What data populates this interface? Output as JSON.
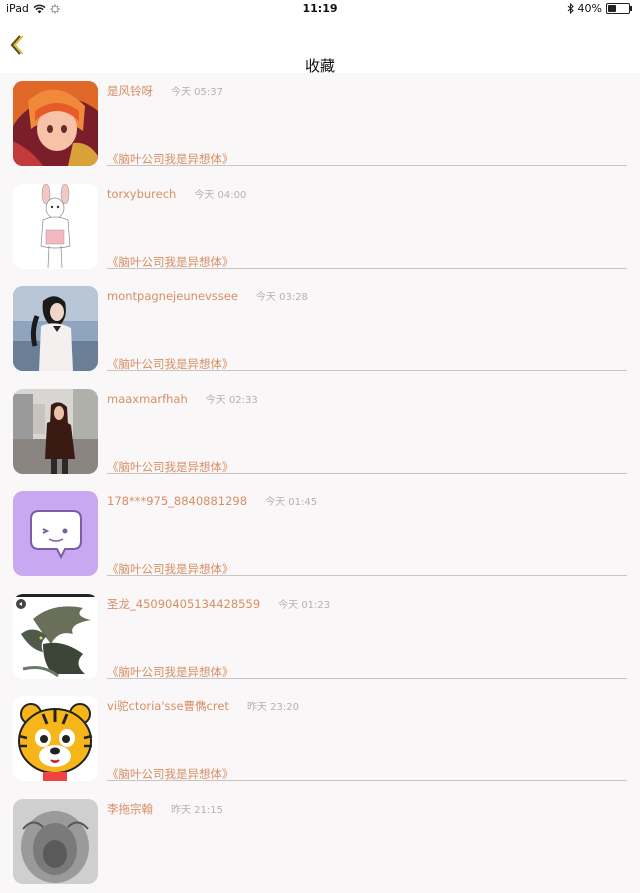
{
  "status": {
    "device": "iPad",
    "time": "11:19",
    "battery": "40%",
    "battery_level": 0.4
  },
  "nav": {
    "title": "收藏"
  },
  "items": [
    {
      "name": "是风铃呀",
      "time": "今天 05:37",
      "post": "《脑叶公司我是异想体》",
      "avatar": "anime-girl"
    },
    {
      "name": "torxyburech",
      "time": "今天 04:00",
      "post": "《脑叶公司我是异想体》",
      "avatar": "rabbit-sketch"
    },
    {
      "name": "montpagnejeunevssee",
      "time": "今天 03:28",
      "post": "《脑叶公司我是异想体》",
      "avatar": "girl-photo"
    },
    {
      "name": "maaxmarfhah",
      "time": "今天 02:33",
      "post": "《脑叶公司我是异想体》",
      "avatar": "street-photo"
    },
    {
      "name": "178***975_8840881298",
      "time": "今天 01:45",
      "post": "《脑叶公司我是异想体》",
      "avatar": "chat-bubble"
    },
    {
      "name": "圣龙_45090405134428559",
      "time": "今天 01:23",
      "post": "《脑叶公司我是异想体》",
      "avatar": "dragon"
    },
    {
      "name": "vi驼ctoria'sse曹儁cret",
      "time": "昨天 23:20",
      "post": "《脑叶公司我是异想体》",
      "avatar": "tiger-cartoon"
    },
    {
      "name": "李拖宗翰",
      "time": "昨天 21:15",
      "post": "",
      "avatar": "lion-sketch"
    }
  ]
}
